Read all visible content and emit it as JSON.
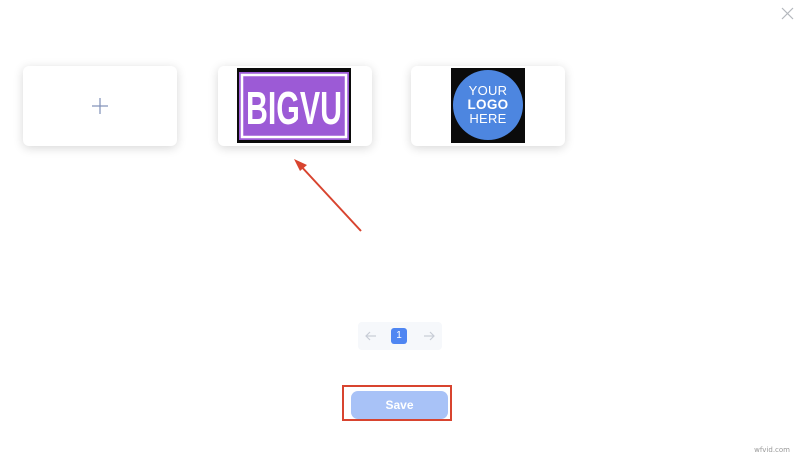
{
  "logos": {
    "add_card": {
      "icon": "plus-icon"
    },
    "bigvu_card": {
      "logo_text": "BIGVU"
    },
    "placeholder_card": {
      "line1": "YOUR",
      "line2": "LOGO",
      "line3": "HERE"
    }
  },
  "pagination": {
    "prev_icon": "arrow-left-icon",
    "current_page": "1",
    "next_icon": "arrow-right-icon"
  },
  "actions": {
    "save_label": "Save"
  },
  "watermark": "wfvid.com",
  "colors": {
    "accent": "#4f86f2",
    "save_disabled": "#a8c2f7",
    "annotation_red": "#d8442f",
    "bigvu_purple": "#9c5ad6",
    "logo_blue": "#4d86e0"
  }
}
